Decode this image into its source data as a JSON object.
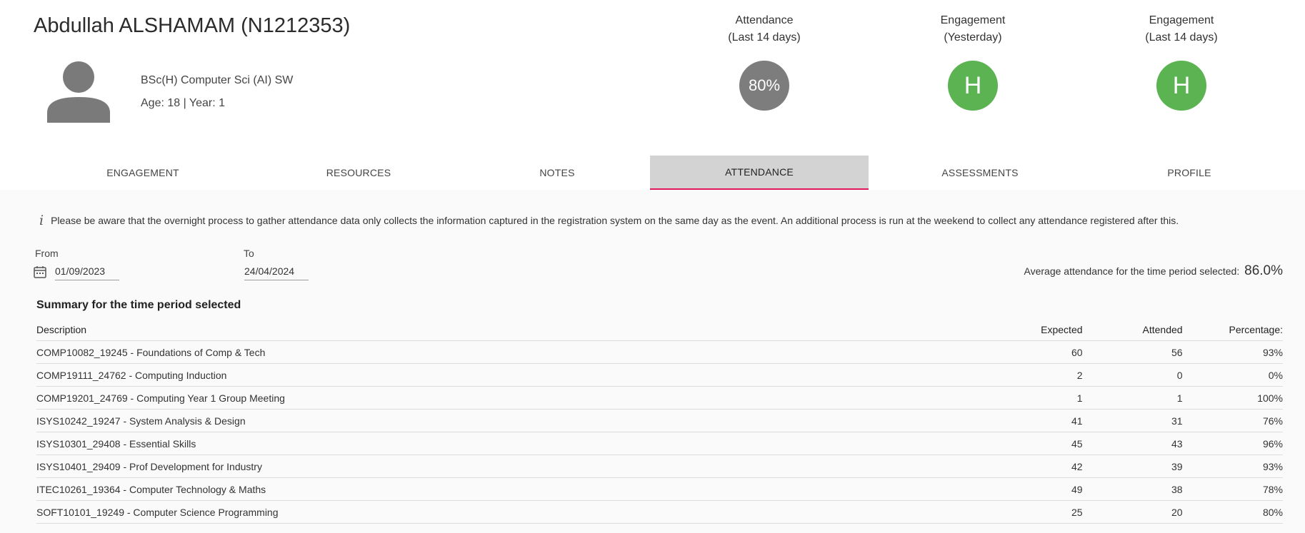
{
  "student": {
    "name": "Abdullah ALSHAMAM (N1212353)",
    "course": "BSc(H) Computer Sci (AI) SW",
    "age_year": "Age: 18 | Year: 1"
  },
  "metrics": [
    {
      "label1": "Attendance",
      "label2": "(Last 14 days)",
      "value": "80%",
      "color": "#7d7d7d"
    },
    {
      "label1": "Engagement",
      "label2": "(Yesterday)",
      "value": "H",
      "color": "#5bb352"
    },
    {
      "label1": "Engagement",
      "label2": "(Last 14 days)",
      "value": "H",
      "color": "#5bb352"
    }
  ],
  "tabs": [
    "ENGAGEMENT",
    "RESOURCES",
    "NOTES",
    "ATTENDANCE",
    "ASSESSMENTS",
    "PROFILE"
  ],
  "active_tab": "ATTENDANCE",
  "notice": "Please be aware that the overnight process to gather attendance data only collects the information captured in the registration system on the same day as the event. An additional process is run at the weekend to collect any attendance registered after this.",
  "filters": {
    "from_label": "From",
    "from_value": "01/09/2023",
    "to_label": "To",
    "to_value": "24/04/2024"
  },
  "average": {
    "label": "Average attendance for the time period selected:",
    "value": "86.0%"
  },
  "summary": {
    "title": "Summary for the time period selected",
    "headers": [
      "Description",
      "Expected",
      "Attended",
      "Percentage:"
    ],
    "rows": [
      [
        "COMP10082_19245 - Foundations of Comp & Tech",
        "60",
        "56",
        "93%"
      ],
      [
        "COMP19111_24762 - Computing Induction",
        "2",
        "0",
        "0%"
      ],
      [
        "COMP19201_24769 - Computing Year 1 Group Meeting",
        "1",
        "1",
        "100%"
      ],
      [
        "ISYS10242_19247 - System Analysis & Design",
        "41",
        "31",
        "76%"
      ],
      [
        "ISYS10301_29408 - Essential Skills",
        "45",
        "43",
        "96%"
      ],
      [
        "ISYS10401_29409 - Prof Development for Industry",
        "42",
        "39",
        "93%"
      ],
      [
        "ITEC10261_19364 - Computer Technology & Maths",
        "49",
        "38",
        "78%"
      ],
      [
        "SOFT10101_19249 - Computer Science Programming",
        "25",
        "20",
        "80%"
      ]
    ]
  }
}
